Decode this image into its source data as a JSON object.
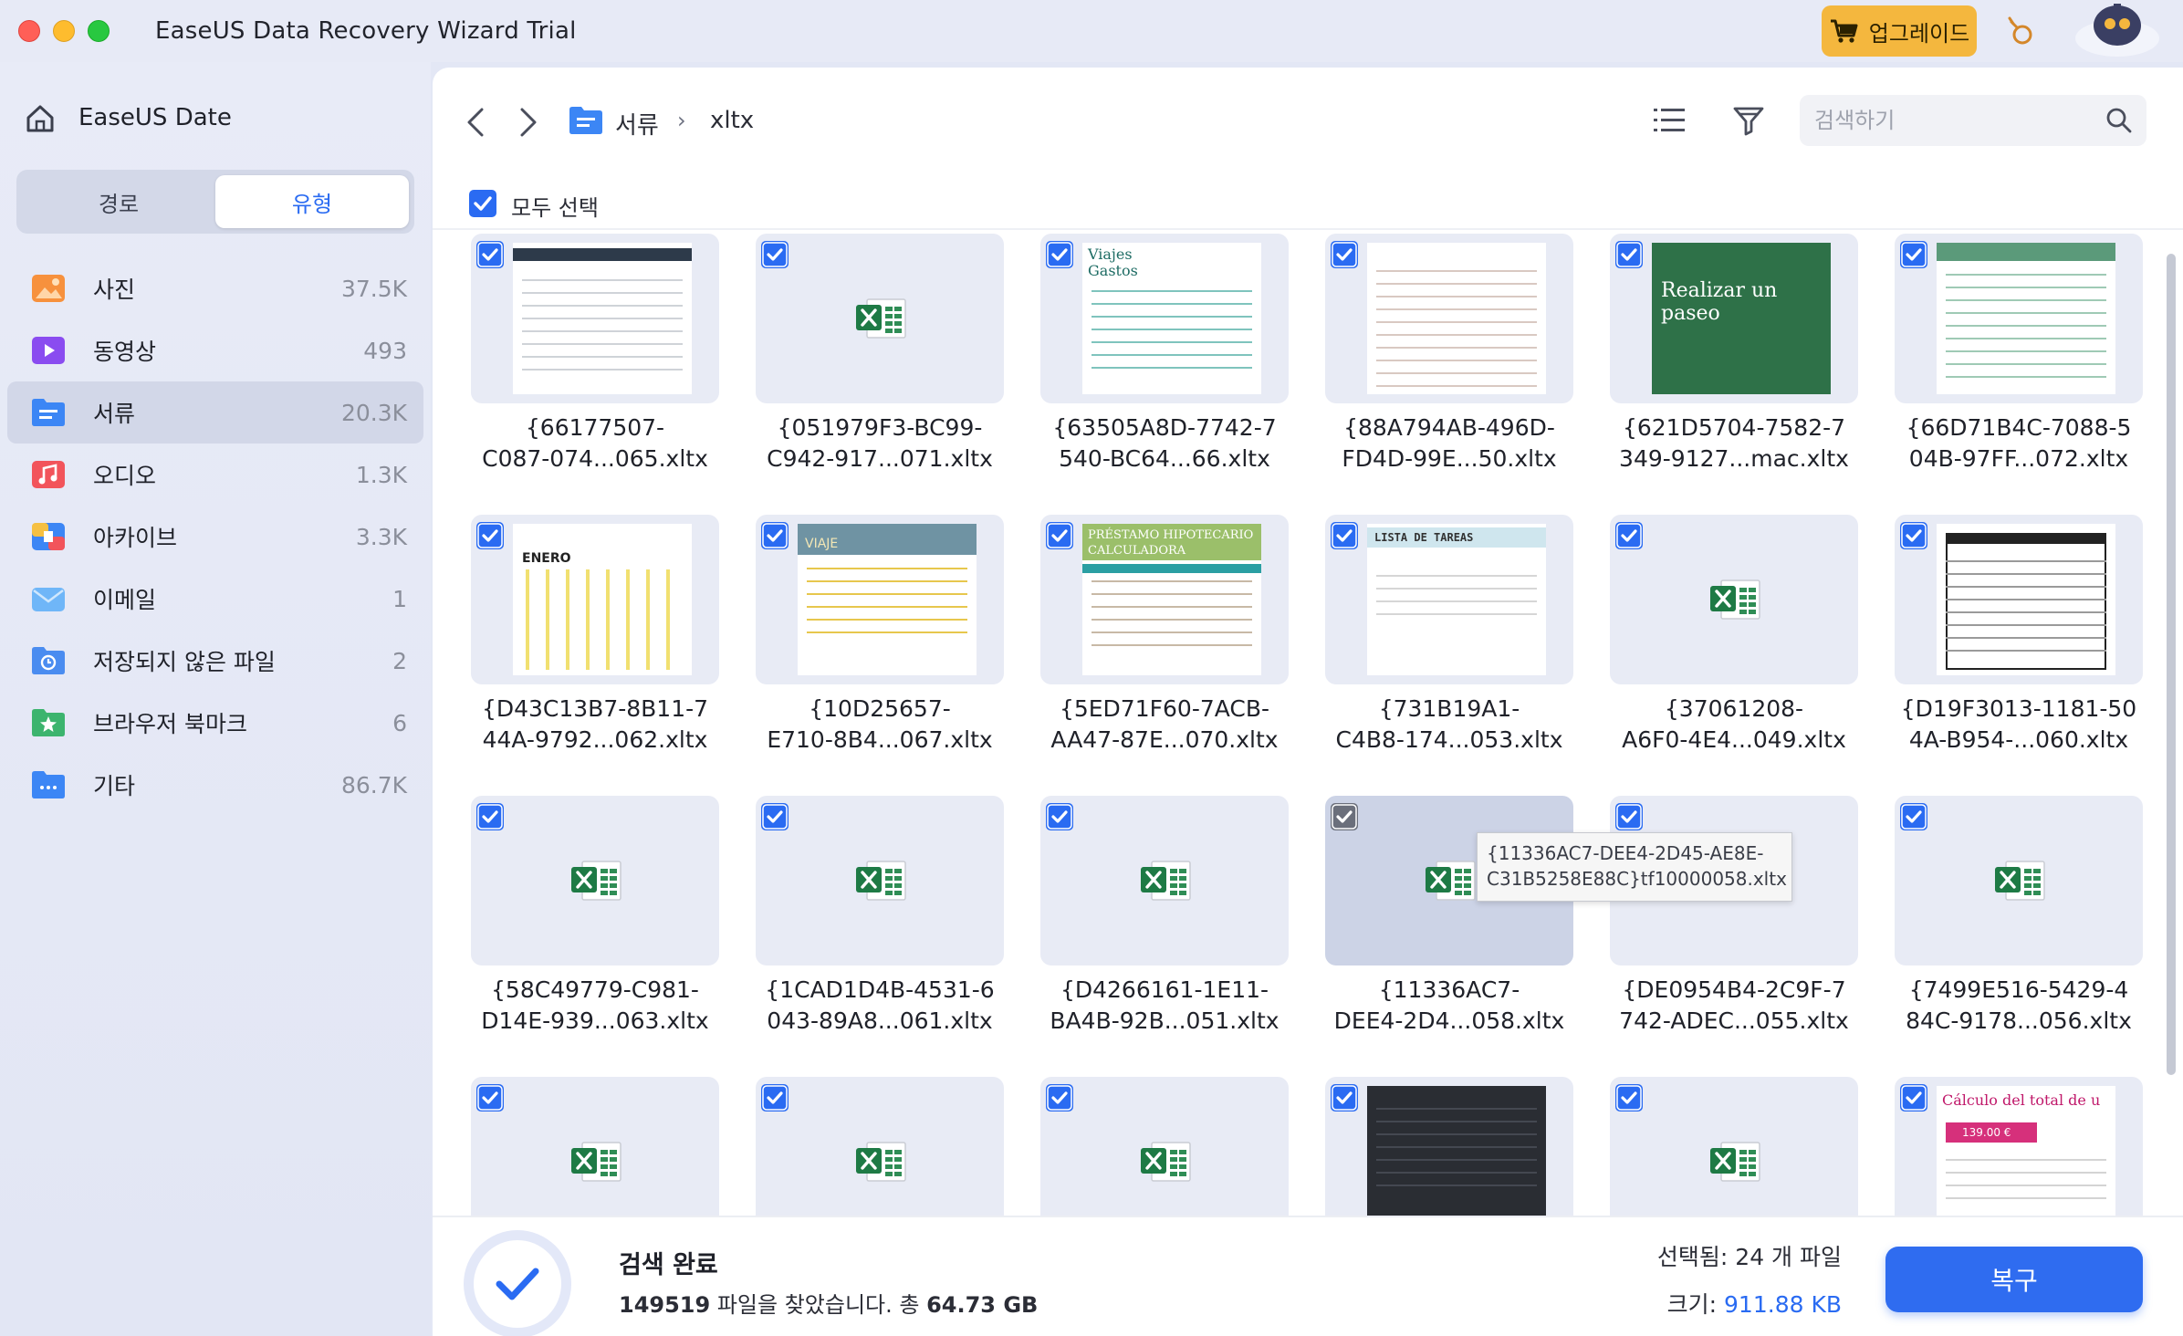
{
  "window": {
    "title": "EaseUS Data Recovery Wizard  Trial",
    "upgrade_label": "업그레이드",
    "colors": {
      "accent": "#2f6cf0",
      "upgrade": "#f4b73e"
    }
  },
  "sidebar": {
    "title": "EaseUS Date",
    "tabs": [
      {
        "label": "경로"
      },
      {
        "label": "유형"
      }
    ],
    "active_tab": "유형",
    "categories": [
      {
        "label": "사진",
        "count": "37.5K",
        "icon": "photo-icon"
      },
      {
        "label": "동영상",
        "count": "493",
        "icon": "video-icon"
      },
      {
        "label": "서류",
        "count": "20.3K",
        "icon": "document-icon"
      },
      {
        "label": "오디오",
        "count": "1.3K",
        "icon": "audio-icon"
      },
      {
        "label": "아카이브",
        "count": "3.3K",
        "icon": "archive-icon"
      },
      {
        "label": "이메일",
        "count": "1",
        "icon": "email-icon"
      },
      {
        "label": "저장되지 않은 파일",
        "count": "2",
        "icon": "unsaved-file-icon"
      },
      {
        "label": "브라우저 북마크",
        "count": "6",
        "icon": "bookmark-icon"
      },
      {
        "label": "기타",
        "count": "86.7K",
        "icon": "other-icon"
      }
    ],
    "active_category": "서류"
  },
  "toolbar": {
    "breadcrumb": [
      "서류",
      "xltx"
    ],
    "separator": "›",
    "search_placeholder": "검색하기",
    "select_all_label": "모두 선택"
  },
  "files": [
    {
      "line1": "{66177507-",
      "line2": "C087-074...065.xltx",
      "preview": "schedule"
    },
    {
      "line1": "{051979F3-BC99-",
      "line2": "C942-917...071.xltx",
      "preview": "excel"
    },
    {
      "line1": "{63505A8D-7742-7",
      "line2": "540-BC64...66.xltx",
      "preview": "travel",
      "text": "Viajes\nGastos"
    },
    {
      "line1": "{88A794AB-496D-",
      "line2": "FD4D-99E...50.xltx",
      "preview": "invoice"
    },
    {
      "line1": "{621D5704-7582-7",
      "line2": "349-9127...mac.xltx",
      "preview": "green",
      "text": "Realizar un paseo"
    },
    {
      "line1": "{66D71B4C-7088-5",
      "line2": "04B-97FF...072.xltx",
      "preview": "finance"
    },
    {
      "line1": "{D43C13B7-8B11-7",
      "line2": "44A-9792...062.xltx",
      "preview": "calendar",
      "text": "ENERO"
    },
    {
      "line1": "{10D25657-",
      "line2": "E710-8B4...067.xltx",
      "preview": "trip",
      "text": "VIAJE"
    },
    {
      "line1": "{5ED71F60-7ACB-",
      "line2": "AA47-87E...070.xltx",
      "preview": "loan",
      "text": "PRÉSTAMO HIPOTECARIO\nCALCULADORA"
    },
    {
      "line1": "{731B19A1-",
      "line2": "C4B8-174...053.xltx",
      "preview": "tasks",
      "text": "LISTA DE TAREAS"
    },
    {
      "line1": "{37061208-",
      "line2": "A6F0-4E4...049.xltx",
      "preview": "excel"
    },
    {
      "line1": "{D19F3013-1181-50",
      "line2": "4A-B954-...060.xltx",
      "preview": "table"
    },
    {
      "line1": "{58C49779-C981-",
      "line2": "D14E-939...063.xltx",
      "preview": "excel"
    },
    {
      "line1": "{1CAD1D4B-4531-6",
      "line2": "043-89A8...061.xltx",
      "preview": "excel"
    },
    {
      "line1": "{D4266161-1E11-",
      "line2": "BA4B-92B...051.xltx",
      "preview": "excel"
    },
    {
      "line1": "{11336AC7-",
      "line2": "DEE4-2D4...058.xltx",
      "preview": "excel",
      "hover": true
    },
    {
      "line1": "{DE0954B4-2C9F-7",
      "line2": "742-ADEC...055.xltx",
      "preview": "excel"
    },
    {
      "line1": "{7499E516-5429-4",
      "line2": "84C-9178...056.xltx",
      "preview": "excel"
    },
    {
      "line1": "",
      "line2": "",
      "preview": "excel"
    },
    {
      "line1": "",
      "line2": "",
      "preview": "excel"
    },
    {
      "line1": "",
      "line2": "",
      "preview": "excel"
    },
    {
      "line1": "",
      "line2": "",
      "preview": "dark"
    },
    {
      "line1": "",
      "line2": "",
      "preview": "excel"
    },
    {
      "line1": "",
      "line2": "",
      "preview": "pink",
      "text": "Cálculo del total de u",
      "price": "139.00 €"
    }
  ],
  "tooltip": {
    "line1": "{11336AC7-DEE4-2D45-AE8E-",
    "line2": "C31B5258E88C}tf10000058.xltx"
  },
  "footer": {
    "title": "검색 완료",
    "found_count": "149519",
    "found_text": " 파일을 찾았습니다. 총 ",
    "total_size": "64.73 GB",
    "selected_label": "선택됨: 24 개 파일",
    "size_label": "크기: ",
    "size_value": "911.88 KB",
    "recover_label": "복구"
  }
}
